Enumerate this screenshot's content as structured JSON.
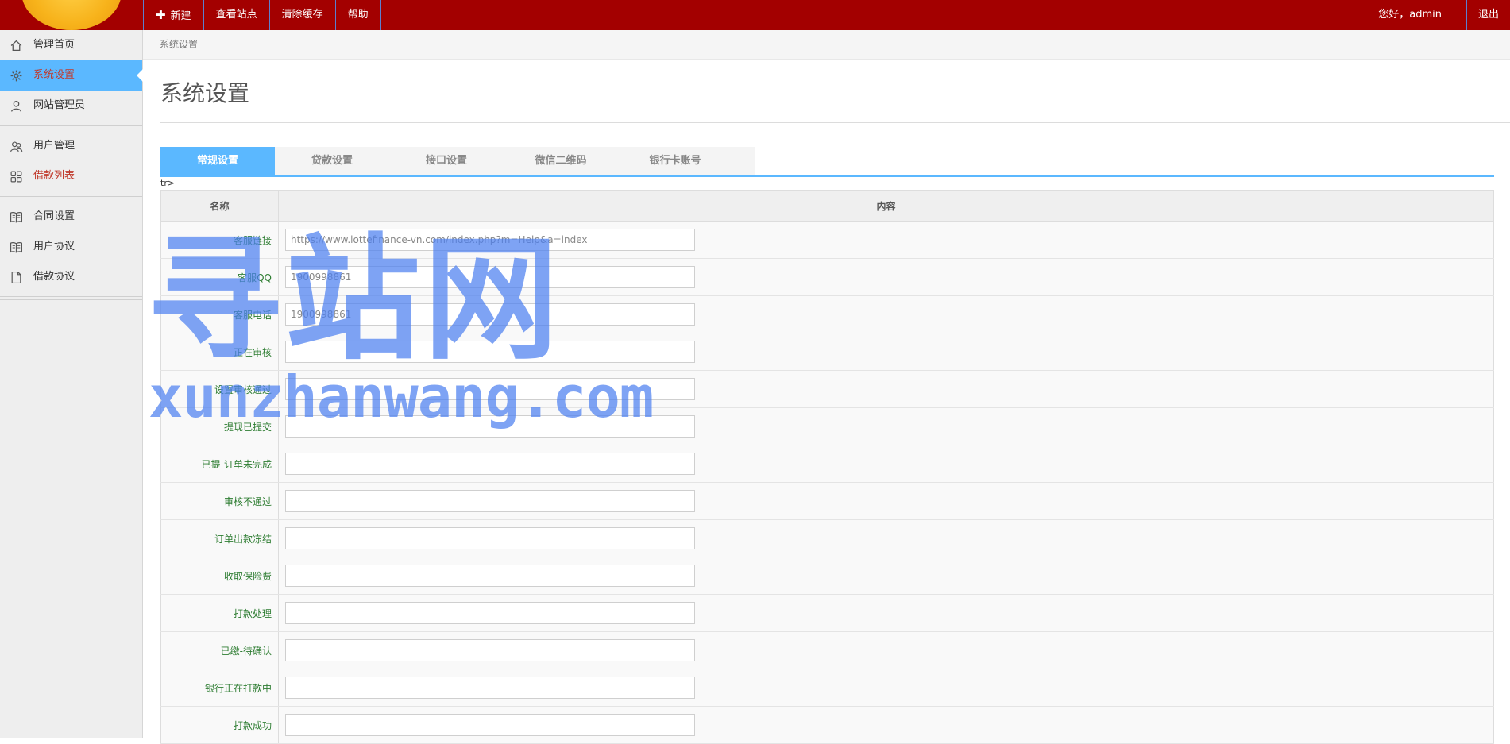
{
  "topbar": {
    "nav": [
      {
        "label": "新建",
        "icon": "plus-icon"
      },
      {
        "label": "查看站点"
      },
      {
        "label": "清除缓存"
      },
      {
        "label": "帮助"
      }
    ],
    "greeting": "您好，admin",
    "logout": "退出"
  },
  "sidebar": {
    "groups": [
      [
        {
          "label": "管理首页",
          "icon": "home-icon"
        },
        {
          "label": "系统设置",
          "icon": "gear-icon",
          "active": true
        },
        {
          "label": "网站管理员",
          "icon": "user-icon"
        }
      ],
      [
        {
          "label": "用户管理",
          "icon": "users-icon"
        },
        {
          "label": "借款列表",
          "icon": "grid-icon",
          "highlight": true
        }
      ],
      [
        {
          "label": "合同设置",
          "icon": "book-icon"
        },
        {
          "label": "用户协议",
          "icon": "book-icon"
        },
        {
          "label": "借款协议",
          "icon": "document-icon"
        }
      ]
    ]
  },
  "breadcrumb": "系统设置",
  "page_title": "系统设置",
  "tabs": [
    "常规设置",
    "贷款设置",
    "接口设置",
    "微信二维码",
    "银行卡账号"
  ],
  "active_tab": 0,
  "stray_text": "tr>",
  "table": {
    "headers": [
      "名称",
      "内容"
    ],
    "rows": [
      {
        "label": "客服链接",
        "value": "https://www.lottefinance-vn.com/index.php?m=Help&a=index"
      },
      {
        "label": "客服QQ",
        "value": "1900998861"
      },
      {
        "label": "客服电话",
        "value": "1900998861"
      },
      {
        "label": "正在审核",
        "value": ""
      },
      {
        "label": "设置审核通过",
        "value": ""
      },
      {
        "label": "提现已提交",
        "value": ""
      },
      {
        "label": "已提-订单未完成",
        "value": ""
      },
      {
        "label": "审核不通过",
        "value": ""
      },
      {
        "label": "订单出款冻结",
        "value": ""
      },
      {
        "label": "收取保险费",
        "value": ""
      },
      {
        "label": "打款处理",
        "value": ""
      },
      {
        "label": "已缴-待确认",
        "value": ""
      },
      {
        "label": "银行正在打款中",
        "value": ""
      },
      {
        "label": "打款成功",
        "value": ""
      }
    ]
  },
  "watermark": {
    "cn": "寻站网",
    "en": "xunzhanwang.com"
  },
  "colors": {
    "topbar": "#a30000",
    "accent": "#5bb8ff",
    "label_green": "#2e7d32",
    "highlight_red": "#c0392b"
  }
}
